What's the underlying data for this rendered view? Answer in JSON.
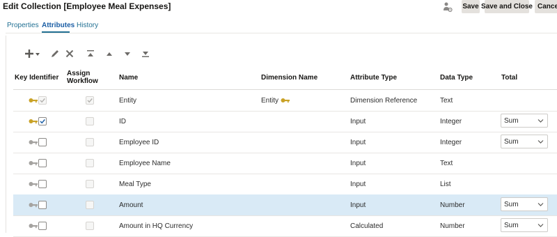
{
  "page": {
    "title": "Edit Collection [Employee Meal Expenses]"
  },
  "actions": {
    "save_label": "Save",
    "save_close_label": "Save and Close",
    "cancel_label": "Cancel"
  },
  "tabs": [
    {
      "label": "Properties",
      "active": false
    },
    {
      "label": "Attributes",
      "active": true
    },
    {
      "label": "History",
      "active": false
    }
  ],
  "toolbar": {
    "icons": [
      "add-icon",
      "edit-icon",
      "delete-icon",
      "move-top-icon",
      "move-up-icon",
      "move-down-icon",
      "move-bottom-icon"
    ]
  },
  "table": {
    "headers": {
      "key_identifier": "Key Identifier",
      "assign_workflow": "Assign Workflow",
      "name": "Name",
      "dimension_name": "Dimension Name",
      "attribute_type": "Attribute Type",
      "data_type": "Data Type",
      "total": "Total"
    },
    "rows": [
      {
        "key_identifier": true,
        "key_disabled": true,
        "assign_workflow": true,
        "workflow_disabled": true,
        "name": "Entity",
        "dimension_name": "Entity",
        "attribute_type": "Dimension Reference",
        "data_type": "Text",
        "total": ""
      },
      {
        "key_identifier": true,
        "key_disabled": false,
        "assign_workflow": false,
        "workflow_disabled": true,
        "name": "ID",
        "dimension_name": "",
        "attribute_type": "Input",
        "data_type": "Integer",
        "total": "Sum"
      },
      {
        "key_identifier": false,
        "key_disabled": false,
        "assign_workflow": false,
        "workflow_disabled": true,
        "name": "Employee ID",
        "dimension_name": "",
        "attribute_type": "Input",
        "data_type": "Integer",
        "total": "Sum"
      },
      {
        "key_identifier": false,
        "key_disabled": false,
        "assign_workflow": false,
        "workflow_disabled": true,
        "name": "Employee Name",
        "dimension_name": "",
        "attribute_type": "Input",
        "data_type": "Text",
        "total": ""
      },
      {
        "key_identifier": false,
        "key_disabled": false,
        "assign_workflow": false,
        "workflow_disabled": true,
        "name": "Meal Type",
        "dimension_name": "",
        "attribute_type": "Input",
        "data_type": "List",
        "total": ""
      },
      {
        "key_identifier": false,
        "key_disabled": false,
        "assign_workflow": false,
        "workflow_disabled": true,
        "name": "Amount",
        "dimension_name": "",
        "attribute_type": "Input",
        "data_type": "Number",
        "total": "Sum",
        "selected": true
      },
      {
        "key_identifier": false,
        "key_disabled": false,
        "assign_workflow": false,
        "workflow_disabled": true,
        "name": "Amount in HQ Currency",
        "dimension_name": "",
        "attribute_type": "Calculated",
        "data_type": "Number",
        "total": "Sum"
      }
    ]
  },
  "colors": {
    "accent": "#227093",
    "selected_row": "#d9eaf6",
    "key_gold": "#c9a227",
    "key_gray": "#a5a3a0"
  }
}
